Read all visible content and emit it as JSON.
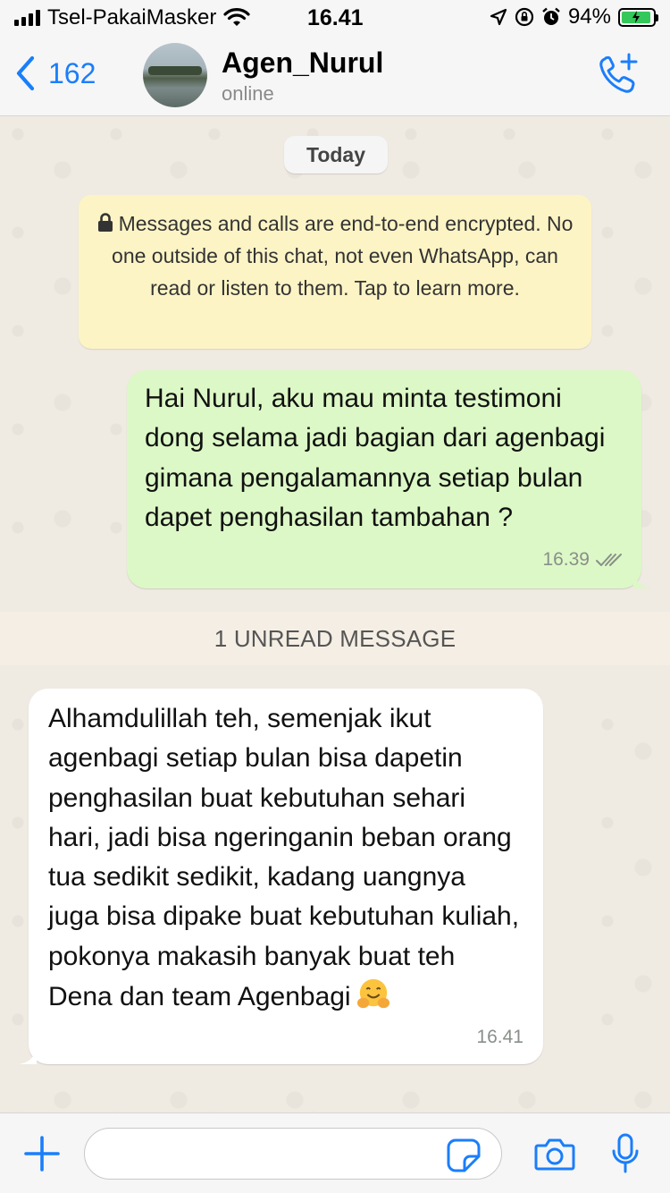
{
  "status_bar": {
    "carrier": "Tsel-PakaiMasker",
    "time": "16.41",
    "battery_percent": "94%",
    "battery_level": 0.94
  },
  "header": {
    "back_count": "162",
    "contact_name": "Agen_Nurul",
    "contact_status": "online"
  },
  "chat": {
    "date_label": "Today",
    "encryption_notice": "Messages and calls are end-to-end encrypted. No one outside of this chat, not even WhatsApp, can read or listen to them. Tap to learn more.",
    "unread_banner": "1 UNREAD MESSAGE",
    "messages": [
      {
        "direction": "outgoing",
        "text": "Hai Nurul, aku mau minta testimoni dong selama jadi bagian dari agenbagi gimana pengalamannya setiap bulan dapet penghasilan tambahan ?",
        "time": "16.39",
        "status": "read"
      },
      {
        "direction": "incoming",
        "text": "Alhamdulillah teh, semenjak ikut agenbagi setiap bulan bisa dapetin penghasilan buat kebutuhan sehari hari, jadi bisa ngeringanin beban orang tua sedikit sedikit, kadang uangnya juga bisa dipake buat kebutuhan kuliah, pokonya makasih banyak buat teh Dena dan team Agenbagi",
        "emoji": "hugging-face",
        "time": "16.41"
      }
    ]
  },
  "input": {
    "placeholder": ""
  },
  "colors": {
    "accent": "#1a7efb",
    "outgoing_bubble": "#dcf8c6",
    "incoming_bubble": "#ffffff",
    "notice_bg": "#fdf4c5",
    "chat_bg": "#efeae2"
  }
}
